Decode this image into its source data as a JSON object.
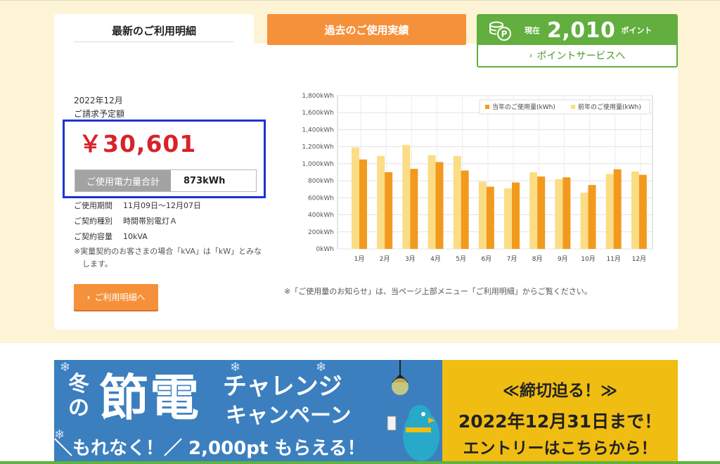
{
  "tabs": {
    "latest": "最新のご利用明細",
    "past": "過去のご使用実績"
  },
  "points": {
    "current_label": "現在",
    "value": "2,010",
    "unit": "ポイント",
    "link_label": "ポイントサービスへ"
  },
  "billing": {
    "month": "2022年12月",
    "amount_label": "ご請求予定額",
    "amount": "￥30,601",
    "usage_label": "ご使用電力量合計",
    "usage_value": "873kWh",
    "period_label": "ご使用期間",
    "period_value": "11月09日～12月07日",
    "contract_type_label": "ご契約種別",
    "contract_type_value": "時間帯別電灯Ａ",
    "capacity_label": "ご契約容量",
    "capacity_value": "10kVA",
    "note": "※実量契約のお客さまの場合「kVA」は「kW」とみなします。",
    "detail_button": "ご利用明細へ"
  },
  "chart_note": "※「ご使用量のお知らせ」は、当ページ上部メニュー「ご利用明細」からご覧ください。",
  "colors": {
    "current_year": "#f29a1e",
    "previous_year": "#fbdd86",
    "accent_orange": "#f5913a",
    "point_green": "#62ae3e",
    "amount_red": "#d8232a"
  },
  "chart_data": {
    "type": "bar",
    "categories": [
      "1月",
      "2月",
      "3月",
      "4月",
      "5月",
      "6月",
      "7月",
      "8月",
      "9月",
      "10月",
      "11月",
      "12月"
    ],
    "series": [
      {
        "name": "前年のご使用量(kWh)",
        "values": [
          1190,
          1090,
          1220,
          1100,
          1090,
          790,
          710,
          900,
          820,
          660,
          880,
          910
        ]
      },
      {
        "name": "当年のご使用量(kWh)",
        "values": [
          1050,
          900,
          940,
          1020,
          920,
          730,
          780,
          850,
          840,
          750,
          935,
          870
        ]
      }
    ],
    "yticks": [
      "0kWh",
      "200kWh",
      "400kWh",
      "600kWh",
      "800kWh",
      "1,000kWh",
      "1,200kWh",
      "1,400kWh",
      "1,600kWh",
      "1,800kWh"
    ],
    "ylim": [
      0,
      1800
    ],
    "legend_position": "top-right",
    "grid": true
  },
  "banner": {
    "fuyu_no": "冬の",
    "setsuden": "節電",
    "challenge": "チャレンジ",
    "campaign": "キャンペーン",
    "morae": "＼もれなく！／ 2,000pt もらえる！",
    "deadline": "≪締切迫る！≫",
    "date": "2022年12月31日まで！",
    "entry": "エントリーはこちらから！"
  }
}
